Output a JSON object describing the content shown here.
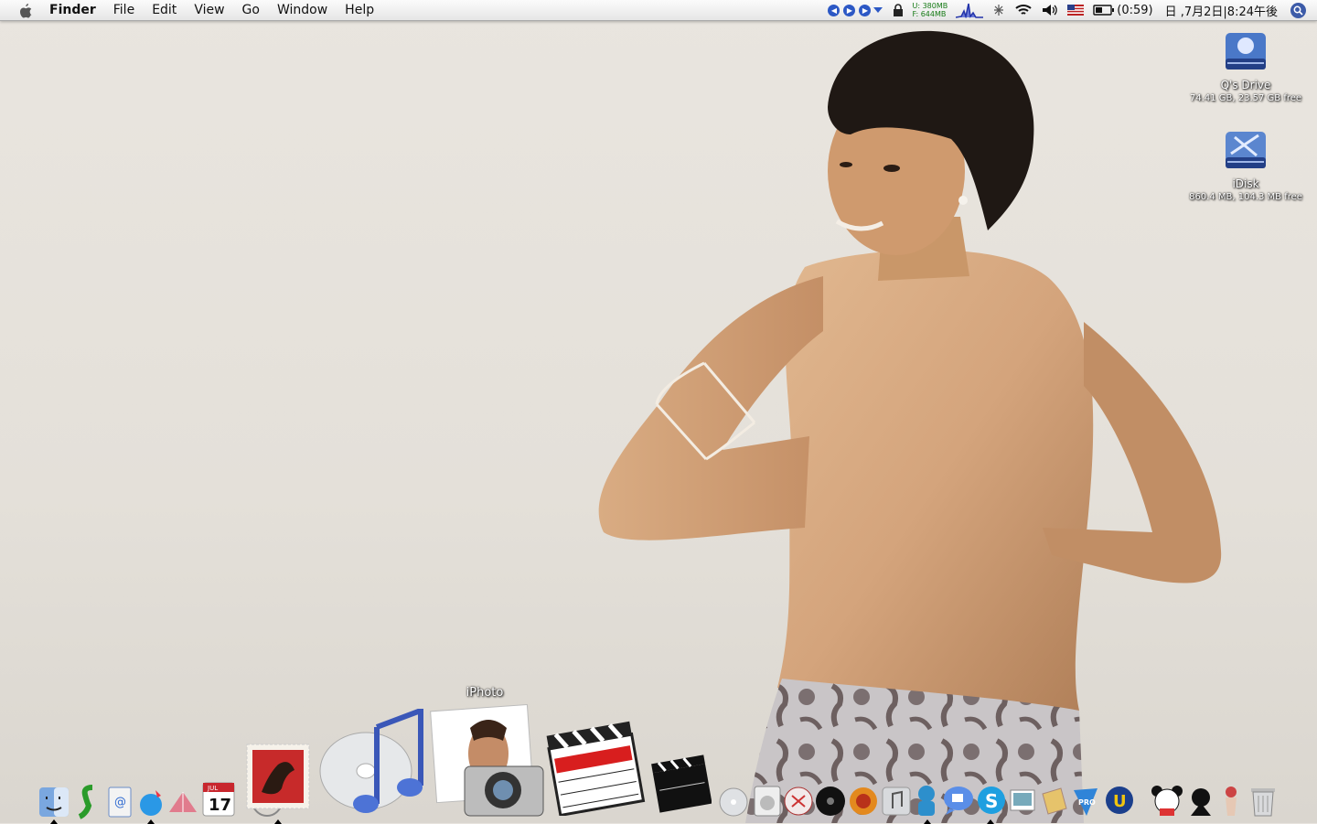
{
  "menubar": {
    "app_name": "Finder",
    "menus": [
      "File",
      "Edit",
      "View",
      "Go",
      "Window",
      "Help"
    ],
    "memory": {
      "used_label": "U:",
      "used_value": "380MB",
      "free_label": "F:",
      "free_value": "644MB"
    },
    "battery": "(0:59)",
    "clock": "日 ,7月2日|8:24午後"
  },
  "desktop": {
    "icons": [
      {
        "name": "Q's Drive",
        "info": "74.41 GB, 23.57 GB free"
      },
      {
        "name": "iDisk",
        "info": "860.4 MB, 104.3 MB free"
      }
    ]
  },
  "dock": {
    "hover_label": "iPhoto",
    "items": [
      "finder-icon",
      "snake-app-icon",
      "address-book-icon",
      "safari-icon",
      "kite-app-icon",
      "ical-icon",
      "mail-stamp-icon",
      "itunes-icon",
      "iphoto-icon",
      "final-cut-icon",
      "imovie-icon",
      "dvd-drive-icon",
      "dvd-player-icon",
      "dvd-studio-icon",
      "photo-slides-icon",
      "music-app-icon",
      "app-store-icon",
      "ichat-icon",
      "skype-icon",
      "preview-icon",
      "jpeg-icon",
      "pro-app-icon",
      "u-app-icon",
      "panda-icon",
      "dog-icon",
      "figure-icon",
      "trash-icon"
    ],
    "calendar_day": "17",
    "calendar_month": "JUL"
  },
  "colors": {
    "menubar": "#ececec",
    "wallpaper": "#e6e2dc",
    "accent": "#2c58c5"
  }
}
